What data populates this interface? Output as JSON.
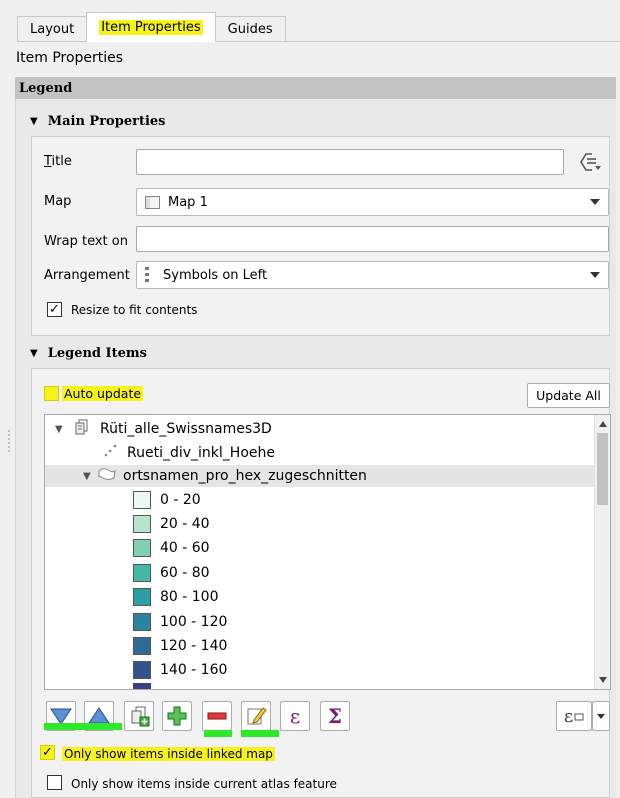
{
  "tabs": [
    {
      "label": "Layout"
    },
    {
      "label": "Item Properties"
    },
    {
      "label": "Guides"
    }
  ],
  "panel_title": "Item Properties",
  "section_title": "Legend",
  "main_properties": {
    "heading": "Main Properties",
    "title_label": "Title",
    "title_value": "",
    "map_label": "Map",
    "map_value": "Map 1",
    "wrap_label": "Wrap text on",
    "wrap_value": "",
    "arrangement_label": "Arrangement",
    "arrangement_value": "Symbols on Left",
    "resize_label": "Resize to fit contents",
    "resize_checked": "✓"
  },
  "legend_items": {
    "heading": "Legend Items",
    "auto_update_label": "Auto update",
    "update_all_label": "Update All",
    "tree": {
      "group_name": "Rüti_alle_Swissnames3D",
      "layer_points": "Rueti_div_inkl_Hoehe",
      "layer_polygons": "ortsnamen_pro_hex_zugeschnitten",
      "classes": [
        {
          "label": "0 - 20",
          "color": "#edf8f3"
        },
        {
          "label": "20 - 40",
          "color": "#b9e3cc"
        },
        {
          "label": "40 - 60",
          "color": "#7fd0b1"
        },
        {
          "label": "60 - 80",
          "color": "#44b8a4"
        },
        {
          "label": "80 - 100",
          "color": "#2b9fa5"
        },
        {
          "label": "100 - 120",
          "color": "#2b849f"
        },
        {
          "label": "120 - 140",
          "color": "#2f6b99"
        },
        {
          "label": "140 - 160",
          "color": "#36528e"
        }
      ]
    },
    "tools": {
      "epsilon": "ε",
      "sigma": "Σ"
    },
    "only_linked_label": "Only show items inside linked map",
    "only_linked_checked": "✓",
    "only_atlas_label": "Only show items inside current atlas feature"
  },
  "colors": {
    "highlight": "#f6f31a",
    "annotation_green": "#2ee82a",
    "section_bar": "#c3c3c3"
  }
}
